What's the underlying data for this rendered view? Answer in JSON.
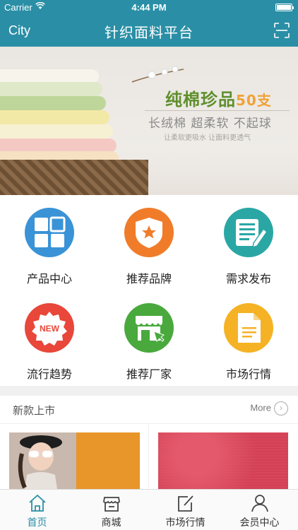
{
  "status_bar": {
    "carrier": "Carrier",
    "time": "4:44 PM"
  },
  "nav": {
    "city": "City",
    "title": "针织面料平台",
    "right_icon": "scan-icon"
  },
  "banner": {
    "headline": "纯棉珍品",
    "headline_number": "50支",
    "subtitle": "长绒棉 超柔软 不起球",
    "fine_print": "让柔软更吸水 让面料更透气"
  },
  "grid": [
    {
      "label": "产品中心",
      "icon": "product-center-icon",
      "color": "#3a93d6"
    },
    {
      "label": "推荐品牌",
      "icon": "recommended-brand-icon",
      "color": "#f07c2a"
    },
    {
      "label": "需求发布",
      "icon": "demand-publish-icon",
      "color": "#2aa7a5"
    },
    {
      "label": "流行趋势",
      "icon": "trend-new-icon",
      "color": "#e8473a"
    },
    {
      "label": "推荐厂家",
      "icon": "recommended-factory-icon",
      "color": "#49a93d"
    },
    {
      "label": "市场行情",
      "icon": "market-document-icon",
      "color": "#f5b224"
    }
  ],
  "new_arrivals": {
    "title": "新款上市",
    "more": "More"
  },
  "tabs": [
    {
      "label": "首页",
      "icon": "home-icon",
      "active": true
    },
    {
      "label": "商城",
      "icon": "store-icon",
      "active": false
    },
    {
      "label": "市场行情",
      "icon": "edit-icon",
      "active": false
    },
    {
      "label": "会员中心",
      "icon": "user-icon",
      "active": false
    }
  ],
  "colors": {
    "primary": "#2a8fa6",
    "active_tab": "#2a8fa6"
  }
}
